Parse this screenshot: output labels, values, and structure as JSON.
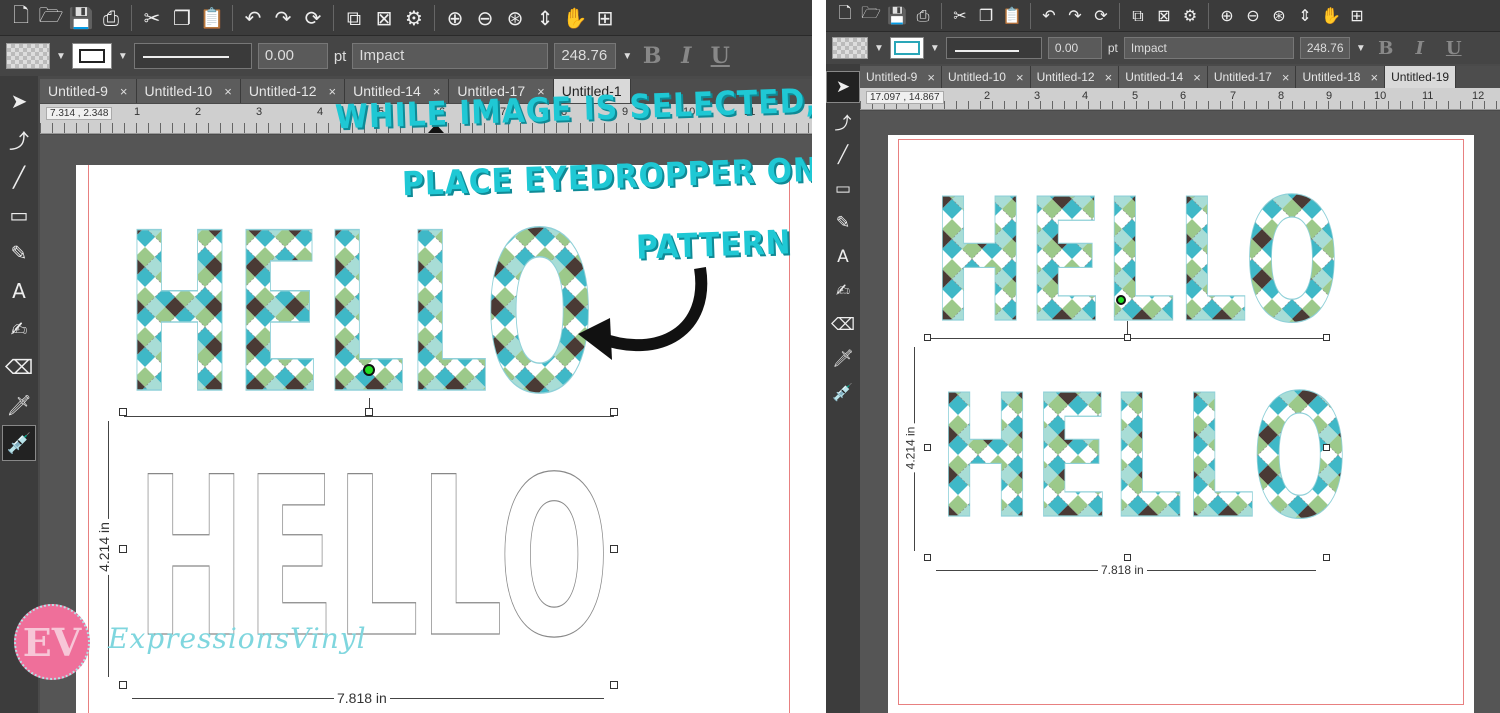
{
  "colors": {
    "pattern_teal": "#3fb8c7",
    "pattern_green": "#9cc98a",
    "pattern_brown": "#4a3a35",
    "pattern_white": "#ffffff",
    "annotation": "#1fc8d4",
    "margin": "#e88080",
    "watermark_pink": "#ef6f9a"
  },
  "toolbar": {
    "icons": [
      "new-document-icon",
      "open-folder-icon",
      "save-icon",
      "print-icon",
      "cut-icon",
      "copy-icon",
      "paste-icon",
      "undo-icon",
      "redo-icon",
      "refresh-icon",
      "group-icon",
      "ungroup-icon",
      "settings-icon",
      "zoom-in-icon",
      "zoom-out-icon",
      "zoom-fit-icon",
      "move-icon",
      "pan-hand-icon",
      "grid-icon"
    ]
  },
  "properties": {
    "line_width": "0.00",
    "line_unit": "pt",
    "font": "Impact",
    "font_size": "248.76",
    "bold": "B",
    "italic": "I",
    "underline": "U"
  },
  "tools": [
    "select-tool-icon",
    "node-edit-icon",
    "line-tool-icon",
    "rectangle-tool-icon",
    "pen-tool-icon",
    "text-tool-icon",
    "image-edit-icon",
    "eraser-icon",
    "knife-icon",
    "eyedropper-icon"
  ],
  "left": {
    "tabs": [
      {
        "label": "Untitled-9",
        "close": "×"
      },
      {
        "label": "Untitled-10",
        "close": "×"
      },
      {
        "label": "Untitled-12",
        "close": "×"
      },
      {
        "label": "Untitled-14",
        "close": "×"
      },
      {
        "label": "Untitled-17",
        "close": "×"
      },
      {
        "label": "Untitled-1",
        "close": ""
      }
    ],
    "coords": "7.314 , 2.348",
    "ruler_numbers": [
      "1",
      "2",
      "3",
      "4",
      "5",
      "6",
      "7",
      "8",
      "9",
      "10",
      "11"
    ],
    "hello_patterned": "HELLO",
    "hello_outline": "HELLO",
    "height_dim": "4.214 in",
    "width_dim": "7.818 in",
    "annotation_lines": [
      "WHILE IMAGE IS SELECTED,",
      "PLACE EYEDROPPER ON",
      "PATTERN"
    ]
  },
  "right": {
    "tabs": [
      {
        "label": "Untitled-9",
        "close": "×"
      },
      {
        "label": "Untitled-10",
        "close": "×"
      },
      {
        "label": "Untitled-12",
        "close": "×"
      },
      {
        "label": "Untitled-14",
        "close": "×"
      },
      {
        "label": "Untitled-17",
        "close": "×"
      },
      {
        "label": "Untitled-18",
        "close": "×"
      },
      {
        "label": "Untitled-19",
        "close": ""
      }
    ],
    "coords": "17.097 , 14.867",
    "ruler_numbers": [
      "2",
      "3",
      "4",
      "5",
      "6",
      "7",
      "8",
      "9",
      "10",
      "11",
      "12"
    ],
    "hello_top": "HELLO",
    "hello_bottom": "HELLO",
    "height_dim": "4.214 in",
    "width_dim": "7.818 in"
  },
  "watermark": {
    "initials": "EV",
    "brand": "ExpressionsVinyl"
  }
}
